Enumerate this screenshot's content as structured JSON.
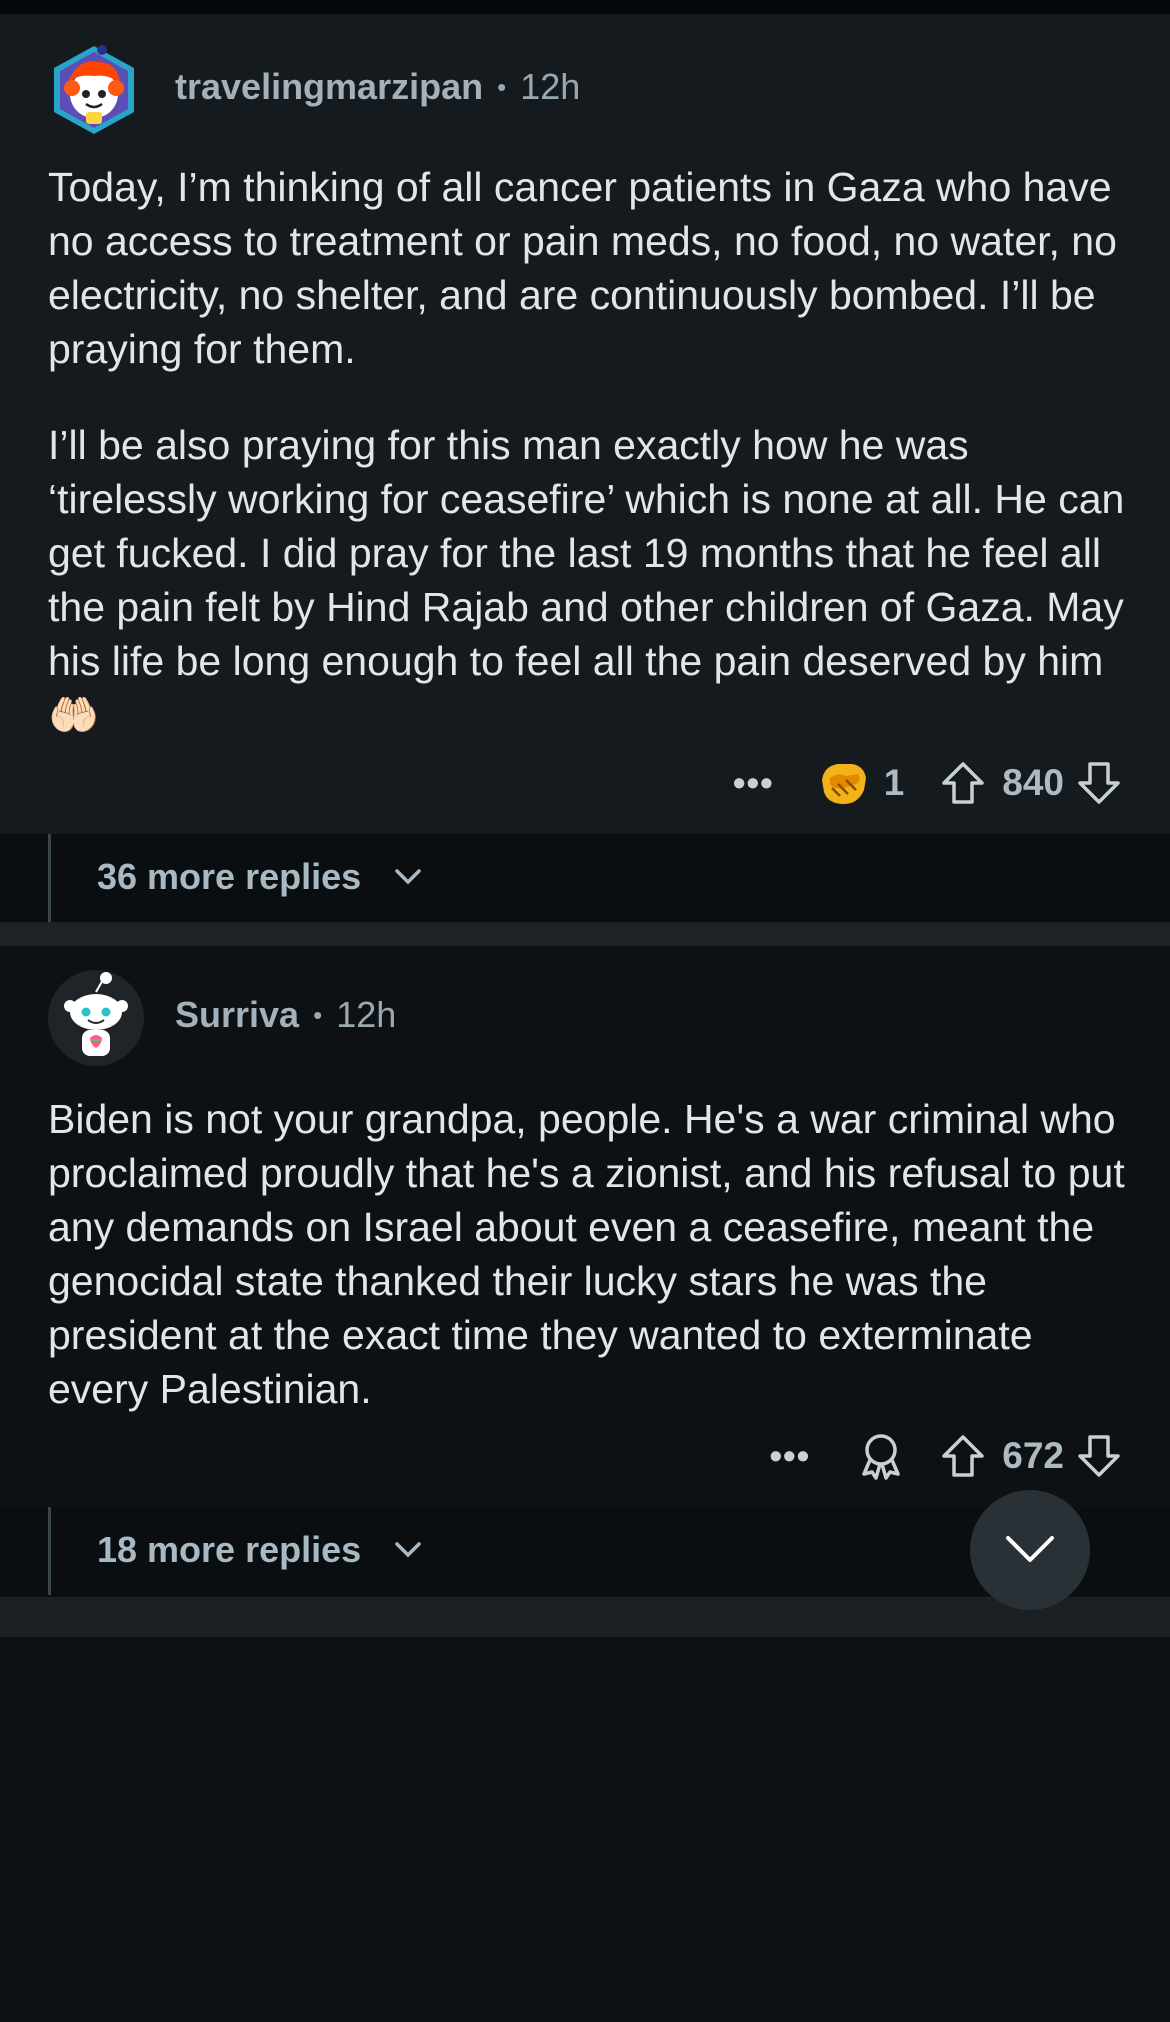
{
  "comments": [
    {
      "username": "travelingmarzipan",
      "separator": "•",
      "time": "12h",
      "paragraphs": [
        "Today, I’m thinking of all cancer patients in Gaza who have no access to treatment or pain meds, no food, no water, no electricity, no shelter, and are continuously bombed. I’ll be praying for them.",
        "I’ll be also praying for this man exactly how he was ‘tirelessly working for ceasefire’ which is none at all. He can get fucked. I did pray for the last 19 months that he feel all the pain felt by Hind Rajab and other children of Gaza. May his life be long enough to feel all the pain deserved by him 🤲🏻"
      ],
      "more_label": "•••",
      "award_count": "1",
      "score": "840",
      "replies_label": "36 more replies"
    },
    {
      "username": "Surriva",
      "separator": "•",
      "time": "12h",
      "paragraphs": [
        "Biden is not your grandpa, people. He's a war criminal who proclaimed proudly that he's a zionist, and his refusal to put any demands on Israel about even a ceasefire, meant the genocidal state thanked their lucky stars he was the president at the exact time they wanted to exterminate every Palestinian."
      ],
      "more_label": "•••",
      "score": "672",
      "replies_label": "18 more replies"
    }
  ],
  "colors": {
    "background": "#0b0d0f",
    "comment_bg": "#151a1e",
    "text": "#e1e6e9",
    "meta": "#9aa8b1",
    "award": "#f2b21b"
  },
  "icons": [
    "avatar-snoo-orange",
    "avatar-snoo-white",
    "award-handshake-icon",
    "award-outline-icon",
    "upvote-icon",
    "downvote-icon",
    "chevron-down-icon",
    "scroll-down-icon"
  ]
}
